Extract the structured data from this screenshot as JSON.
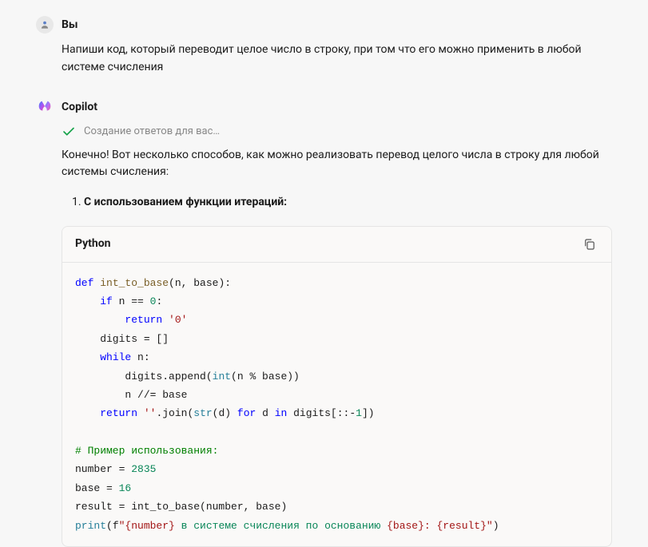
{
  "user": {
    "name": "Вы",
    "message": "Напиши код, который переводит целое число в строку, при том что его можно применить в любой системе счисления"
  },
  "assistant": {
    "name": "Copilot",
    "status": "Создание ответов для вас…",
    "intro": "Конечно! Вот несколько способов, как можно реализовать перевод целого числа в строку для любой системы счисления:",
    "list": {
      "marker": "1.",
      "label": "С использованием функции итераций:"
    },
    "code": {
      "lang": "Python",
      "tokens": {
        "def": "def",
        "fn_name": "int_to_base",
        "params": "(n, base):",
        "if": "if",
        "cond": " n == ",
        "zero": "0",
        "colon": ":",
        "return1": "return",
        "str0": "'0'",
        "digits_init": "    digits = []",
        "while": "while",
        "while_cond": " n:",
        "append_pre": "        digits.append(",
        "int_fn": "int",
        "append_post": "(n % base))",
        "floor_div": "        n //= base",
        "return2": "return",
        "join_pre": " ",
        "empty_str": "''",
        "join_mid": ".join(",
        "str_fn": "str",
        "join_after_str": "(d) ",
        "for": "for",
        "for_mid": " d ",
        "in": "in",
        "for_end": " digits[::-",
        "one": "1",
        "for_close": "])",
        "comment": "# Пример использования:",
        "number_lbl": "number = ",
        "number_val": "2835",
        "base_lbl": "base = ",
        "base_val": "16",
        "result_line": "result = int_to_base(number, base)",
        "print": "print",
        "print_open": "(f",
        "fstr_a": "\"{number}",
        "fstr_b": " в системе счисления по основанию ",
        "fstr_c": "{base}: {result}\"",
        "print_close": ")"
      }
    }
  }
}
